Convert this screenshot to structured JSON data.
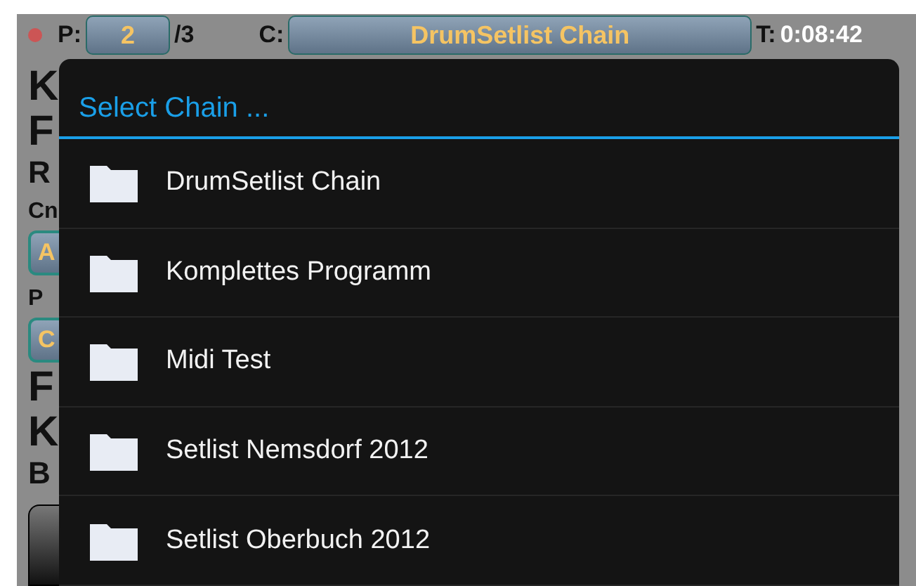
{
  "top_bar": {
    "page_label": "P:",
    "page_value": "2",
    "page_total": "/3",
    "chain_label": "C:",
    "chain_value": "DrumSetlist Chain",
    "time_label": "T:",
    "time_value": "0:08:42"
  },
  "left_strip": [
    {
      "kind": "big",
      "text": "K"
    },
    {
      "kind": "big",
      "text": "F"
    },
    {
      "kind": "mid",
      "text": "R"
    },
    {
      "kind": "small",
      "text": "Cn"
    },
    {
      "kind": "button",
      "text": "A"
    },
    {
      "kind": "small",
      "text": "P"
    },
    {
      "kind": "button",
      "text": "C"
    },
    {
      "kind": "big",
      "text": "F"
    },
    {
      "kind": "big",
      "text": "K"
    },
    {
      "kind": "mid",
      "text": "B"
    }
  ],
  "dialog": {
    "title": "Select Chain ...",
    "items": [
      {
        "label": "DrumSetlist Chain"
      },
      {
        "label": "Komplettes Programm"
      },
      {
        "label": "Midi Test"
      },
      {
        "label": "Setlist Nemsdorf 2012"
      },
      {
        "label": "Setlist Oberbuch 2012"
      }
    ]
  }
}
